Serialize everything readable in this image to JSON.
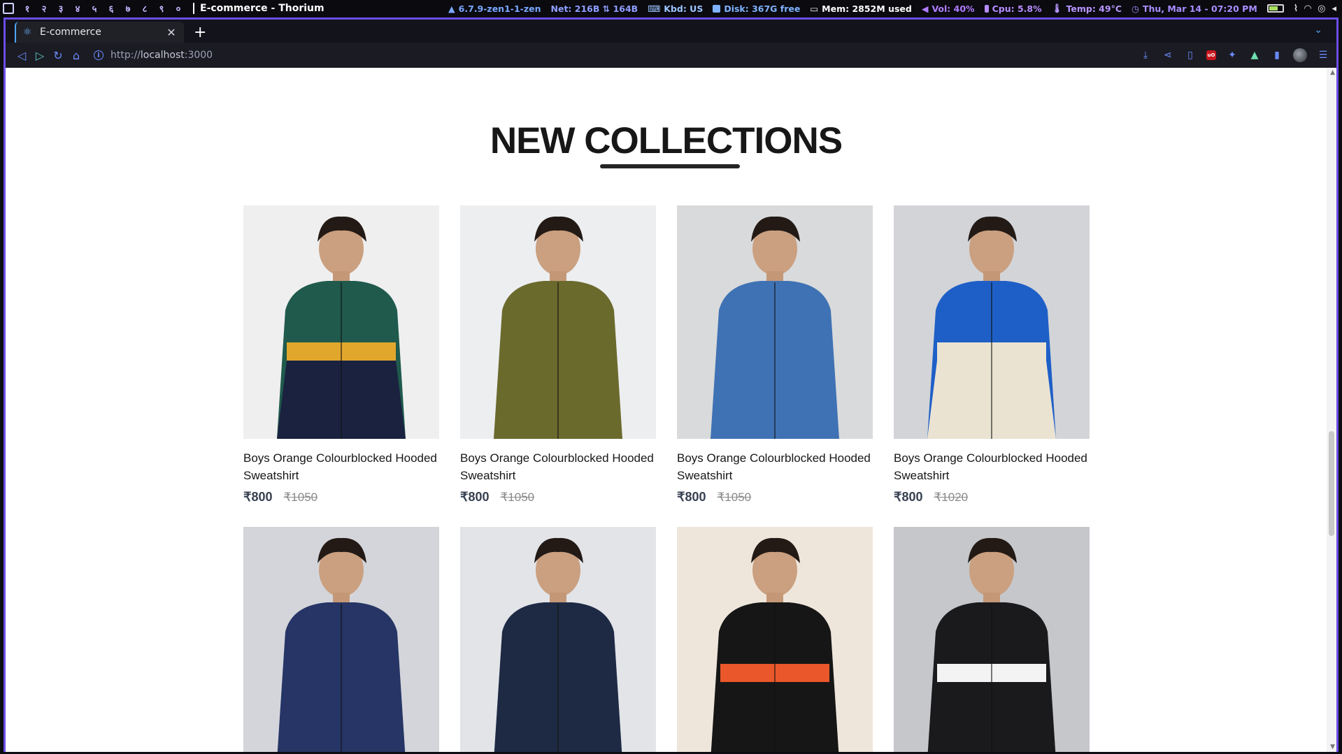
{
  "system_bar": {
    "workspaces": [
      "१",
      "२",
      "३",
      "४",
      "५",
      "६",
      "७",
      "८",
      "९",
      "०"
    ],
    "window_title": "E-commerce - Thorium",
    "kernel": "6.7.9-zen1-1-zen",
    "net": "Net: 216B ⇅ 164B",
    "kbd": "Kbd: US",
    "disk": "Disk: 367G free",
    "mem": "Mem:  2852M used",
    "vol": "Vol: 40%",
    "cpu": "Cpu: 5.8%",
    "temp": "Temp: 49°C",
    "datetime": "Thu, Mar 14 - 07:20 PM",
    "colors": {
      "kernel": "#7aa7ff",
      "net": "#8f9dff",
      "kbd": "#9bc4ff",
      "disk": "#7fb2ff",
      "mem": "#b4b8ff",
      "vol": "#b07cff",
      "cpu": "#b58cff",
      "temp": "#b896ff",
      "datetime": "#a88dff"
    }
  },
  "browser": {
    "tab_label": "E-commerce",
    "new_tab_label": "+",
    "url_scheme": "http://",
    "url_host": "localhost",
    "url_port": ":3000"
  },
  "page": {
    "title": "NEW COLLECTIONS",
    "currency_symbol": "₹",
    "products": [
      {
        "name": "Boys Orange Colourblocked Hooded Sweatshirt",
        "new_price": "₹800",
        "old_price": "₹1050",
        "bg": "#efefef",
        "jacket": "#1f5a4d",
        "accent": "#e1a72c",
        "lower": "#1a2240"
      },
      {
        "name": "Boys Orange Colourblocked Hooded Sweatshirt",
        "new_price": "₹800",
        "old_price": "₹1050",
        "bg": "#eceef0",
        "jacket": "#6b6a2d",
        "accent": "#6b6a2d",
        "lower": "#6b6a2d"
      },
      {
        "name": "Boys Orange Colourblocked Hooded Sweatshirt",
        "new_price": "₹800",
        "old_price": "₹1050",
        "bg": "#d9dadb",
        "jacket": "#3f72b4",
        "accent": "#3f72b4",
        "lower": "#3f72b4"
      },
      {
        "name": "Boys Orange Colourblocked Hooded Sweatshirt",
        "new_price": "₹800",
        "old_price": "₹1020",
        "bg": "#d3d4d8",
        "jacket": "#1e5fc7",
        "accent": "#eae3d2",
        "lower": "#eae3d2"
      },
      {
        "name": "",
        "new_price": "",
        "old_price": "",
        "bg": "#d4d5da",
        "jacket": "#263566",
        "accent": "#263566",
        "lower": "#263566"
      },
      {
        "name": "",
        "new_price": "",
        "old_price": "",
        "bg": "#e2e4e8",
        "jacket": "#1e2a44",
        "accent": "#1e2a44",
        "lower": "#1e2a44"
      },
      {
        "name": "",
        "new_price": "",
        "old_price": "",
        "bg": "#efe6db",
        "jacket": "#161616",
        "accent": "#e9572a",
        "lower": "#161616"
      },
      {
        "name": "",
        "new_price": "",
        "old_price": "",
        "bg": "#c5c7cb",
        "jacket": "#1a1a1c",
        "accent": "#f3f3f3",
        "lower": "#1a1a1c"
      }
    ]
  }
}
